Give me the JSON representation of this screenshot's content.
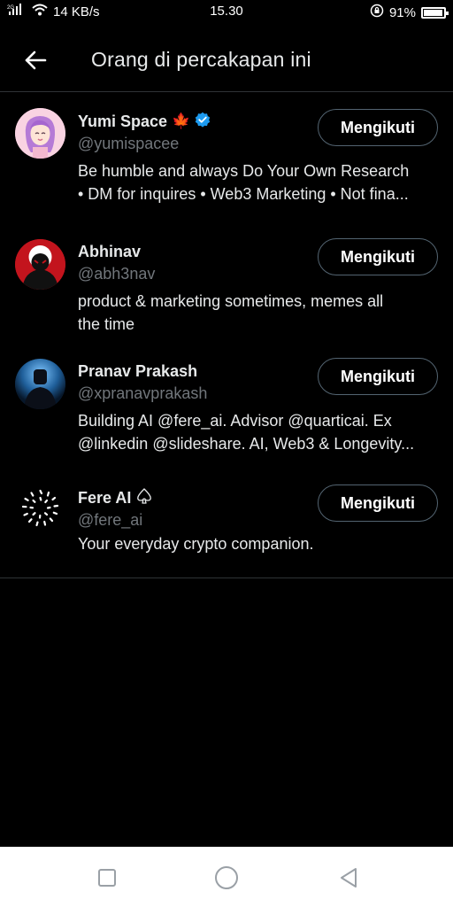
{
  "status_bar": {
    "network": "2G",
    "speed": "14 KB/s",
    "time": "15.30",
    "battery": "91%"
  },
  "header": {
    "title": "Orang di percakapan ini",
    "back_icon": "arrow-left-icon"
  },
  "people": [
    {
      "name": "Yumi Space",
      "emoji": "🍁",
      "verified": true,
      "handle": "@yumispacee",
      "bio_line1": "Be humble and always Do Your Own Research",
      "bio_line2": "• DM for inquires • Web3 Marketing • Not fina...",
      "button": "Mengikuti"
    },
    {
      "name": "Abhinav",
      "handle": "@abh3nav",
      "bio_line1": "product & marketing sometimes, memes all",
      "bio_line2": "the time",
      "button": "Mengikuti"
    },
    {
      "name": "Pranav Prakash",
      "handle": "@xpranavprakash",
      "bio_line1": "Building AI @fere_ai. Advisor @quarticai. Ex",
      "bio_line2": "@linkedin @slideshare. AI, Web3 & Longevity...",
      "button": "Mengikuti"
    },
    {
      "name": "Fere AI",
      "handle": "@fere_ai",
      "bio_line1": "Your everyday crypto companion.",
      "button": "Mengikuti"
    }
  ],
  "navbar": {
    "items": [
      "square-recents-icon",
      "circle-home-icon",
      "triangle-back-icon"
    ]
  },
  "colors": {
    "background": "#000000",
    "primary_text": "#e7e9ea",
    "secondary_text": "#71767b",
    "verified": "#1d9bf0",
    "divider": "#2f3336"
  }
}
